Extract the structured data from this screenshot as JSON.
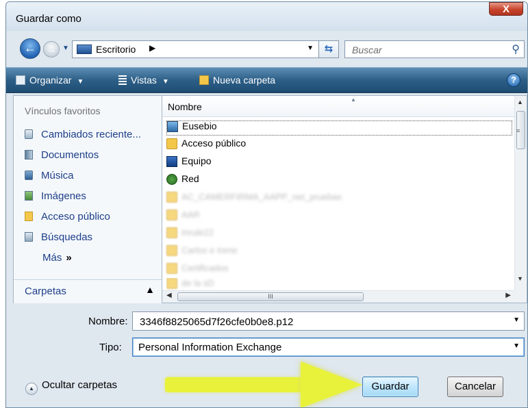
{
  "window": {
    "title": "Guardar como",
    "close_label": "X"
  },
  "navigation": {
    "location": "Escritorio",
    "search_placeholder": "Buscar",
    "back_glyph": "←",
    "forward_glyph": "→"
  },
  "toolbar": {
    "organize_label": "Organizar",
    "views_label": "Vistas",
    "new_folder_label": "Nueva carpeta",
    "help_label": "?"
  },
  "sidebar": {
    "heading": "Vínculos favoritos",
    "items": [
      {
        "label": "Cambiados reciente...",
        "icon": "recent-icon"
      },
      {
        "label": "Documentos",
        "icon": "documents-icon"
      },
      {
        "label": "Música",
        "icon": "music-icon"
      },
      {
        "label": "Imágenes",
        "icon": "images-icon"
      },
      {
        "label": "Acceso público",
        "icon": "public-folder-icon"
      },
      {
        "label": "Búsquedas",
        "icon": "searches-icon"
      }
    ],
    "more_label": "Más",
    "folders_label": "Carpetas"
  },
  "file_list": {
    "column_name": "Nombre",
    "items": [
      {
        "name": "Eusebio",
        "icon": "user-folder-icon",
        "selected": true
      },
      {
        "name": "Acceso público",
        "icon": "folder-icon"
      },
      {
        "name": "Equipo",
        "icon": "computer-icon"
      },
      {
        "name": "Red",
        "icon": "network-icon"
      }
    ],
    "blurred_items": [
      "AC_CAMERFIRMA_AAPP_net_pruebas",
      "AAR",
      "Inrule22",
      "Carlos e Irene",
      "Certificados",
      "de la sD"
    ],
    "hscroll_grip": "III"
  },
  "form": {
    "filename_label": "Nombre:",
    "filename_value": "3346f8825065d7f26cfe0b0e8.p12",
    "type_label": "Tipo:",
    "type_value": "Personal Information Exchange"
  },
  "footer": {
    "hide_folders_label": "Ocultar carpetas",
    "save_label": "Guardar",
    "cancel_label": "Cancelar"
  },
  "colors": {
    "toolbar": "#2d5f87",
    "link": "#1e3e88",
    "highlight_arrow": "#e9f23a",
    "primary_button": "#bee6fd"
  }
}
